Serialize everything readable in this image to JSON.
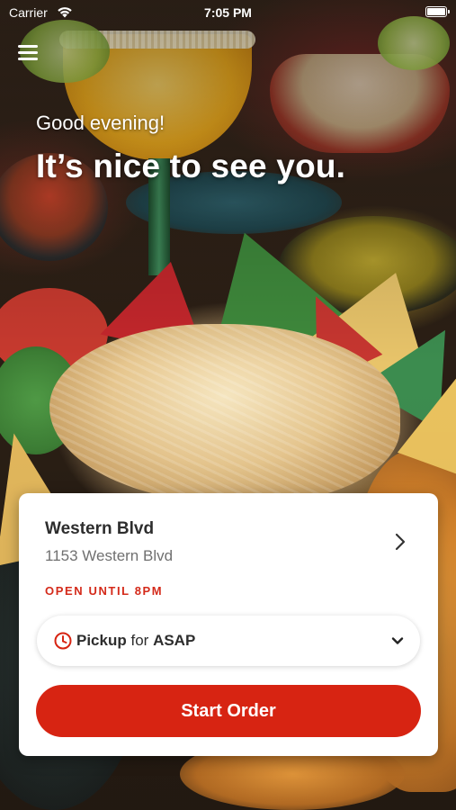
{
  "status_bar": {
    "carrier": "Carrier",
    "time": "7:05 PM"
  },
  "header": {
    "greeting": "Good evening!",
    "headline": "It’s nice to see you."
  },
  "location_card": {
    "name": "Western Blvd",
    "address": "1153 Western Blvd",
    "hours_status": "OPEN UNTIL 8PM",
    "order_mode": "Pickup",
    "order_mode_connector": "for",
    "order_time": "ASAP",
    "start_button": "Start Order"
  },
  "colors": {
    "accent_red": "#d72412",
    "open_status_red": "#d42a1a",
    "card_background": "#ffffff"
  },
  "icons": [
    "menu-icon",
    "wifi-icon",
    "battery-icon",
    "chevron-right-icon",
    "clock-icon",
    "chevron-down-icon"
  ]
}
